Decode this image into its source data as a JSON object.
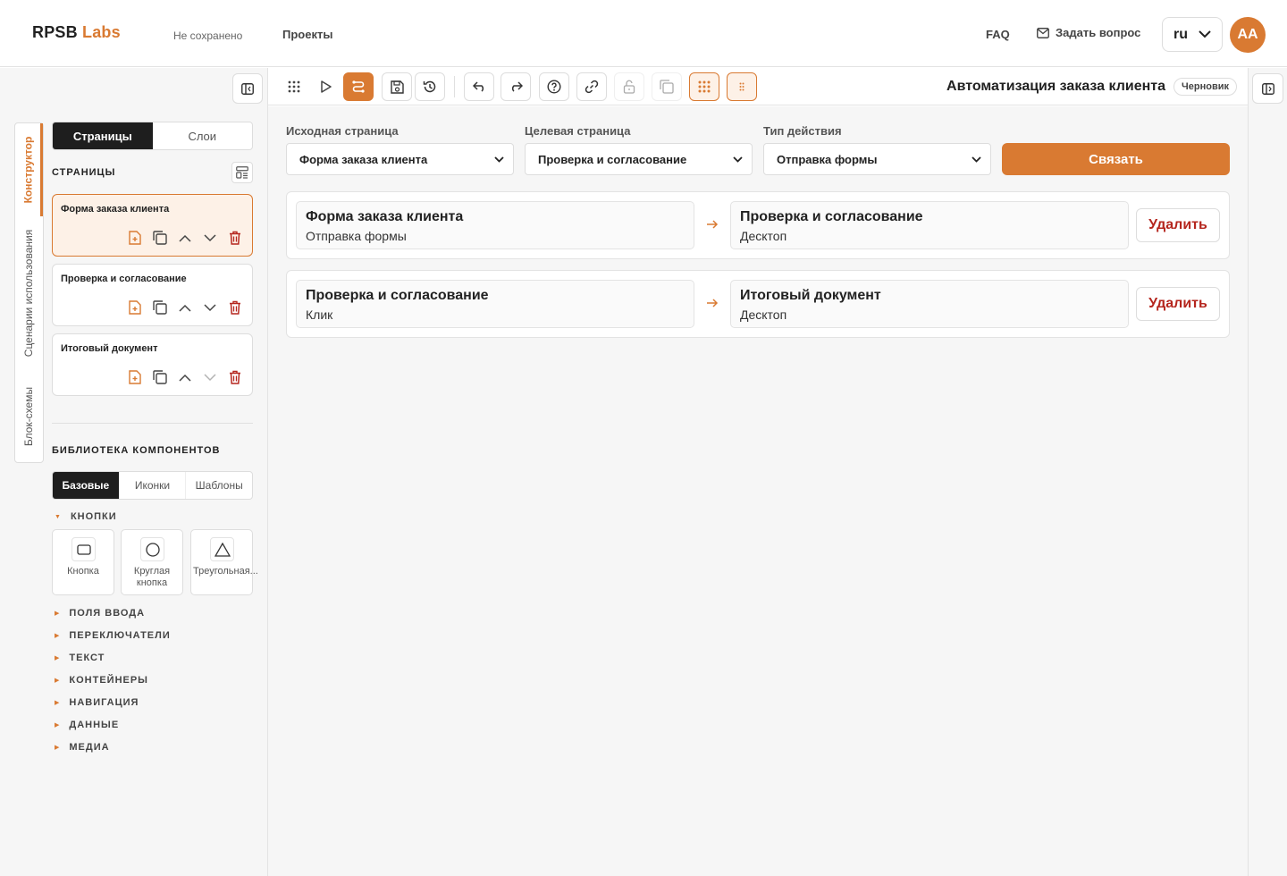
{
  "header": {
    "logo_main": "RPSB",
    "logo_accent": "Labs",
    "save_status": "Не сохранено",
    "nav_projects": "Проекты",
    "nav_faq": "FAQ",
    "nav_ask": "Задать вопрос",
    "language": "ru",
    "avatar_initials": "AA"
  },
  "sidebar": {
    "vertical_tabs": [
      "Конструктор",
      "Сценарии использования",
      "Блок-схемы"
    ],
    "active_vertical_tab": "Конструктор",
    "segment": [
      "Страницы",
      "Слои"
    ],
    "pages_title": "СТРАНИЦЫ",
    "pages": [
      {
        "name": "Форма заказа клиента",
        "active": true
      },
      {
        "name": "Проверка и согласование",
        "active": false
      },
      {
        "name": "Итоговый документ",
        "active": false
      }
    ],
    "library_title": "БИБЛИОТЕКА КОМПОНЕНТОВ",
    "library_tabs": [
      "Базовые",
      "Иконки",
      "Шаблоны"
    ],
    "categories": [
      "КНОПКИ",
      "ПОЛЯ ВВОДА",
      "ПЕРЕКЛЮЧАТЕЛИ",
      "ТЕКСТ",
      "КОНТЕЙНЕРЫ",
      "НАВИГАЦИЯ",
      "ДАННЫЕ",
      "МЕДИА"
    ],
    "components": [
      {
        "label": "Кнопка",
        "icon": "rectangle-icon"
      },
      {
        "label": "Круглая кнопка",
        "icon": "circle-icon"
      },
      {
        "label": "Треугольная...",
        "icon": "triangle-icon"
      }
    ]
  },
  "toolbar": {
    "project_title": "Автоматизация заказа клиента",
    "status_badge": "Черновик"
  },
  "main": {
    "source_label": "Исходная страница",
    "source_value": "Форма заказа клиента",
    "target_label": "Целевая страница",
    "target_value": "Проверка и согласование",
    "action_label": "Тип действия",
    "action_value": "Отправка формы",
    "link_button": "Связать",
    "links": [
      {
        "from": "Форма заказа клиента",
        "from_sub": "Отправка формы",
        "to": "Проверка и согласование",
        "to_sub": "Десктоп",
        "delete": "Удалить"
      },
      {
        "from": "Проверка и согласование",
        "from_sub": "Клик",
        "to": "Итоговый документ",
        "to_sub": "Десктоп",
        "delete": "Удалить"
      }
    ]
  },
  "colors": {
    "accent": "#d97a32",
    "danger": "#b5261e",
    "dark": "#1e1e1e"
  }
}
